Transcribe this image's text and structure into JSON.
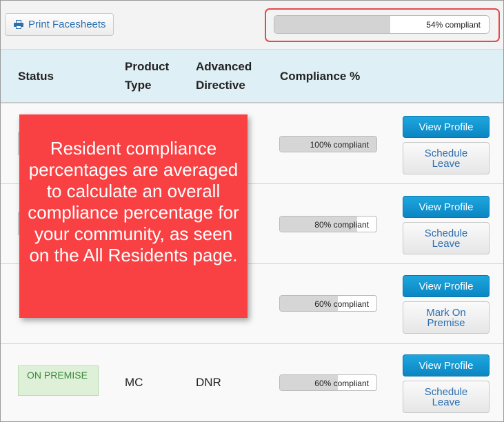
{
  "toolbar": {
    "print_label": "Print Facesheets",
    "print_icon": "printer-icon"
  },
  "overall": {
    "text": "54% compliant",
    "percent": 54,
    "highlight_color": "#e04b4b"
  },
  "table": {
    "headers": {
      "status": "Status",
      "product_type_line1": "Product",
      "product_type_line2": "Type",
      "directive_line1": "Advanced",
      "directive_line2": "Directive",
      "compliance": "Compliance %"
    },
    "rows": [
      {
        "status": "",
        "product_type": "",
        "directive": "",
        "compliance_text": "100% compliant",
        "compliance_percent": 100,
        "primary_action": "View Profile",
        "secondary_action": "Schedule Leave"
      },
      {
        "status": "",
        "product_type": "",
        "directive": "",
        "compliance_text": "80% compliant",
        "compliance_percent": 80,
        "primary_action": "View Profile",
        "secondary_action": "Schedule Leave"
      },
      {
        "status": "",
        "product_type": "",
        "directive": "",
        "compliance_text": "60% compliant",
        "compliance_percent": 60,
        "primary_action": "View Profile",
        "secondary_action": "Mark On Premise"
      },
      {
        "status": "On Premise",
        "product_type": "MC",
        "directive": "DNR",
        "compliance_text": "60% compliant",
        "compliance_percent": 60,
        "primary_action": "View Profile",
        "secondary_action": "Schedule Leave"
      }
    ]
  },
  "callout": {
    "text": "Resident compliance percentages are averaged to calculate an overall compliance percentage for your community, as seen on the All Residents page.",
    "color": "#f94144"
  },
  "colors": {
    "header_bg": "#deeff5",
    "primary_button": "#1ea6df",
    "link": "#2a6fb0",
    "status_badge_bg": "#dff0d8"
  }
}
